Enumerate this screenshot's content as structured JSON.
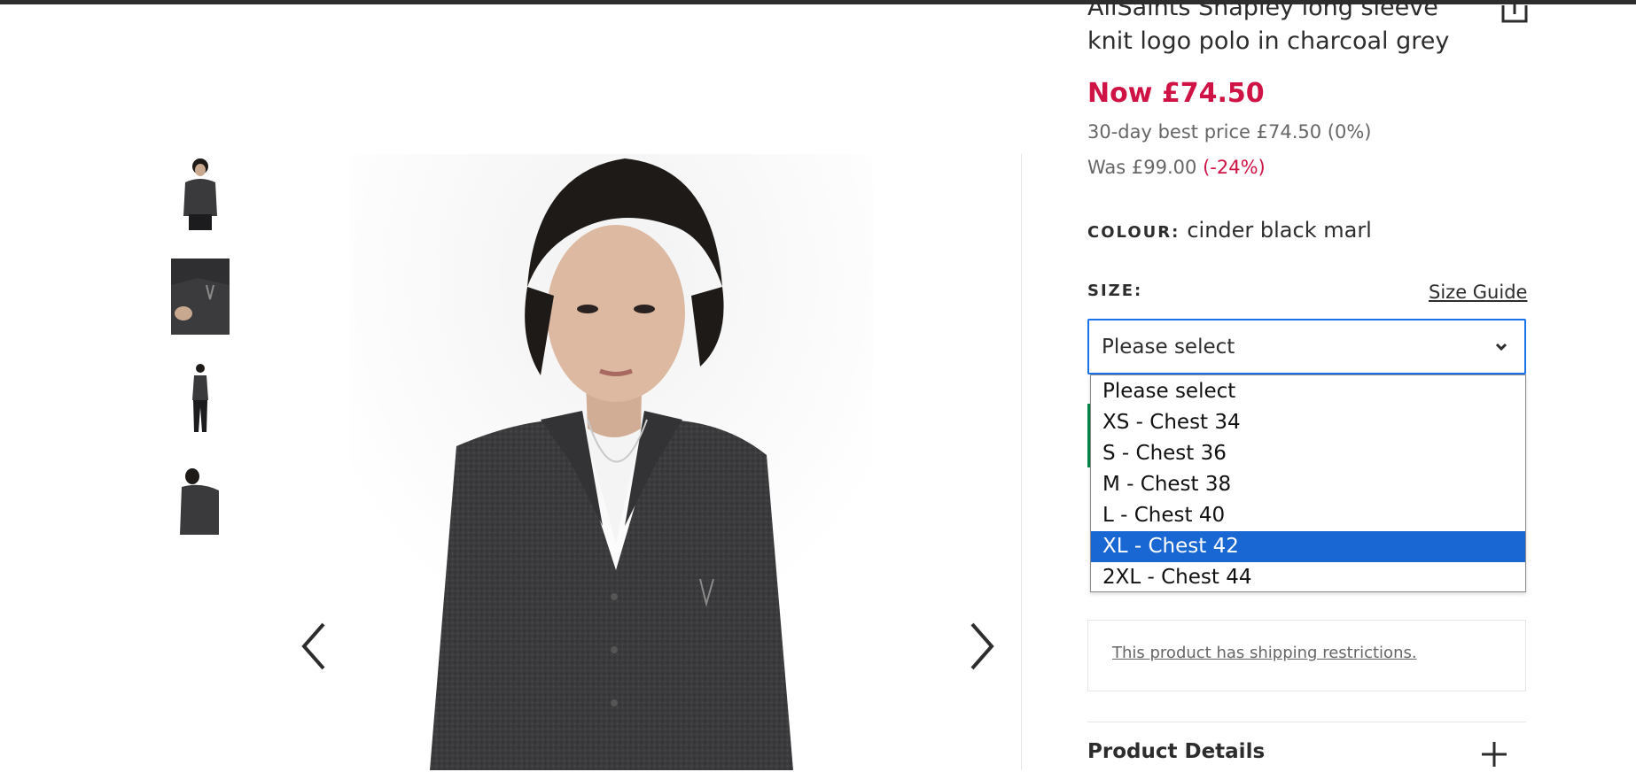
{
  "product": {
    "title": "AllSaints Shapley long sleeve knit logo polo in charcoal grey",
    "price_now": "Now £74.50",
    "best_price": "30-day best price £74.50 (0%)",
    "was_price": "Was £99.00",
    "was_discount": "(-24%)",
    "colour_label": "COLOUR:",
    "colour_value": "cinder black marl"
  },
  "size": {
    "label": "SIZE:",
    "guide_link": "Size Guide",
    "selected": "Please select",
    "options": [
      "Please select",
      "XS - Chest 34",
      "S - Chest 36",
      "M - Chest 38",
      "L - Chest 40",
      "XL - Chest 42",
      "2XL - Chest 44"
    ],
    "highlighted_option": "XL - Chest 42"
  },
  "shipping": {
    "restriction_link": "This product has shipping restrictions."
  },
  "accordion": {
    "product_details": "Product Details"
  },
  "gallery": {
    "thumbnails": [
      "front-view",
      "logo-detail",
      "full-length",
      "back-view"
    ],
    "active_thumbnail": 0
  },
  "icons": {
    "share": "share-icon",
    "prev": "chevron-left-icon",
    "next": "chevron-right-icon",
    "dropdown": "chevron-down-icon",
    "expand": "plus-icon"
  },
  "colors": {
    "price": "#d01345",
    "accent": "#1967d2",
    "stock": "#018849",
    "text": "#2d2d2d"
  }
}
